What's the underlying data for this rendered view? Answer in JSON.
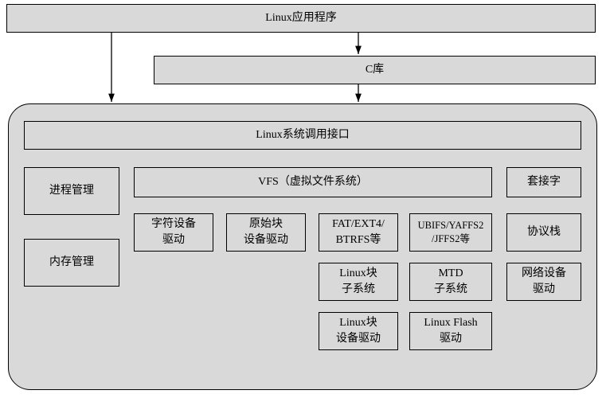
{
  "chart_data": {
    "type": "diagram",
    "title": "Linux 内核系统结构",
    "nodes": [
      {
        "id": "app",
        "label": "Linux应用程序"
      },
      {
        "id": "clib",
        "label": "C库"
      },
      {
        "id": "syscall",
        "label": "Linux系统调用接口"
      },
      {
        "id": "proc",
        "label": "进程管理"
      },
      {
        "id": "mem",
        "label": "内存管理"
      },
      {
        "id": "vfs",
        "label": "VFS（虚拟文件系统）"
      },
      {
        "id": "sock",
        "label": "套接字"
      },
      {
        "id": "chardrv",
        "label": "字符设备\n驱动"
      },
      {
        "id": "rawblk",
        "label": "原始块\n设备驱动"
      },
      {
        "id": "fs1",
        "label": "FAT/EXT4/\nBTRFS等"
      },
      {
        "id": "fs2",
        "label": "UBIFS/YAFFS2\n/JFFS2等"
      },
      {
        "id": "proto",
        "label": "协议栈"
      },
      {
        "id": "blksub",
        "label": "Linux块\n子系统"
      },
      {
        "id": "mtdsub",
        "label": "MTD\n子系统"
      },
      {
        "id": "netdrv",
        "label": "网络设备\n驱动"
      },
      {
        "id": "blkdrv",
        "label": "Linux块\n设备驱动"
      },
      {
        "id": "flashdrv",
        "label": "Linux Flash\n驱动"
      }
    ]
  },
  "app": "Linux应用程序",
  "clib": "C库",
  "syscall": "Linux系统调用接口",
  "proc": "进程管理",
  "mem": "内存管理",
  "vfs": "VFS（虚拟文件系统）",
  "sock": "套接字",
  "chardrv_l1": "字符设备",
  "chardrv_l2": "驱动",
  "rawblk_l1": "原始块",
  "rawblk_l2": "设备驱动",
  "fs1_l1": "FAT/EXT4/",
  "fs1_l2": "BTRFS等",
  "fs2_l1": "UBIFS/YAFFS2",
  "fs2_l2": "/JFFS2等",
  "proto": "协议栈",
  "blksub_l1": "Linux块",
  "blksub_l2": "子系统",
  "mtdsub_l1": "MTD",
  "mtdsub_l2": "子系统",
  "netdrv_l1": "网络设备",
  "netdrv_l2": "驱动",
  "blkdrv_l1": "Linux块",
  "blkdrv_l2": "设备驱动",
  "flashdrv_l1": "Linux Flash",
  "flashdrv_l2": "驱动"
}
